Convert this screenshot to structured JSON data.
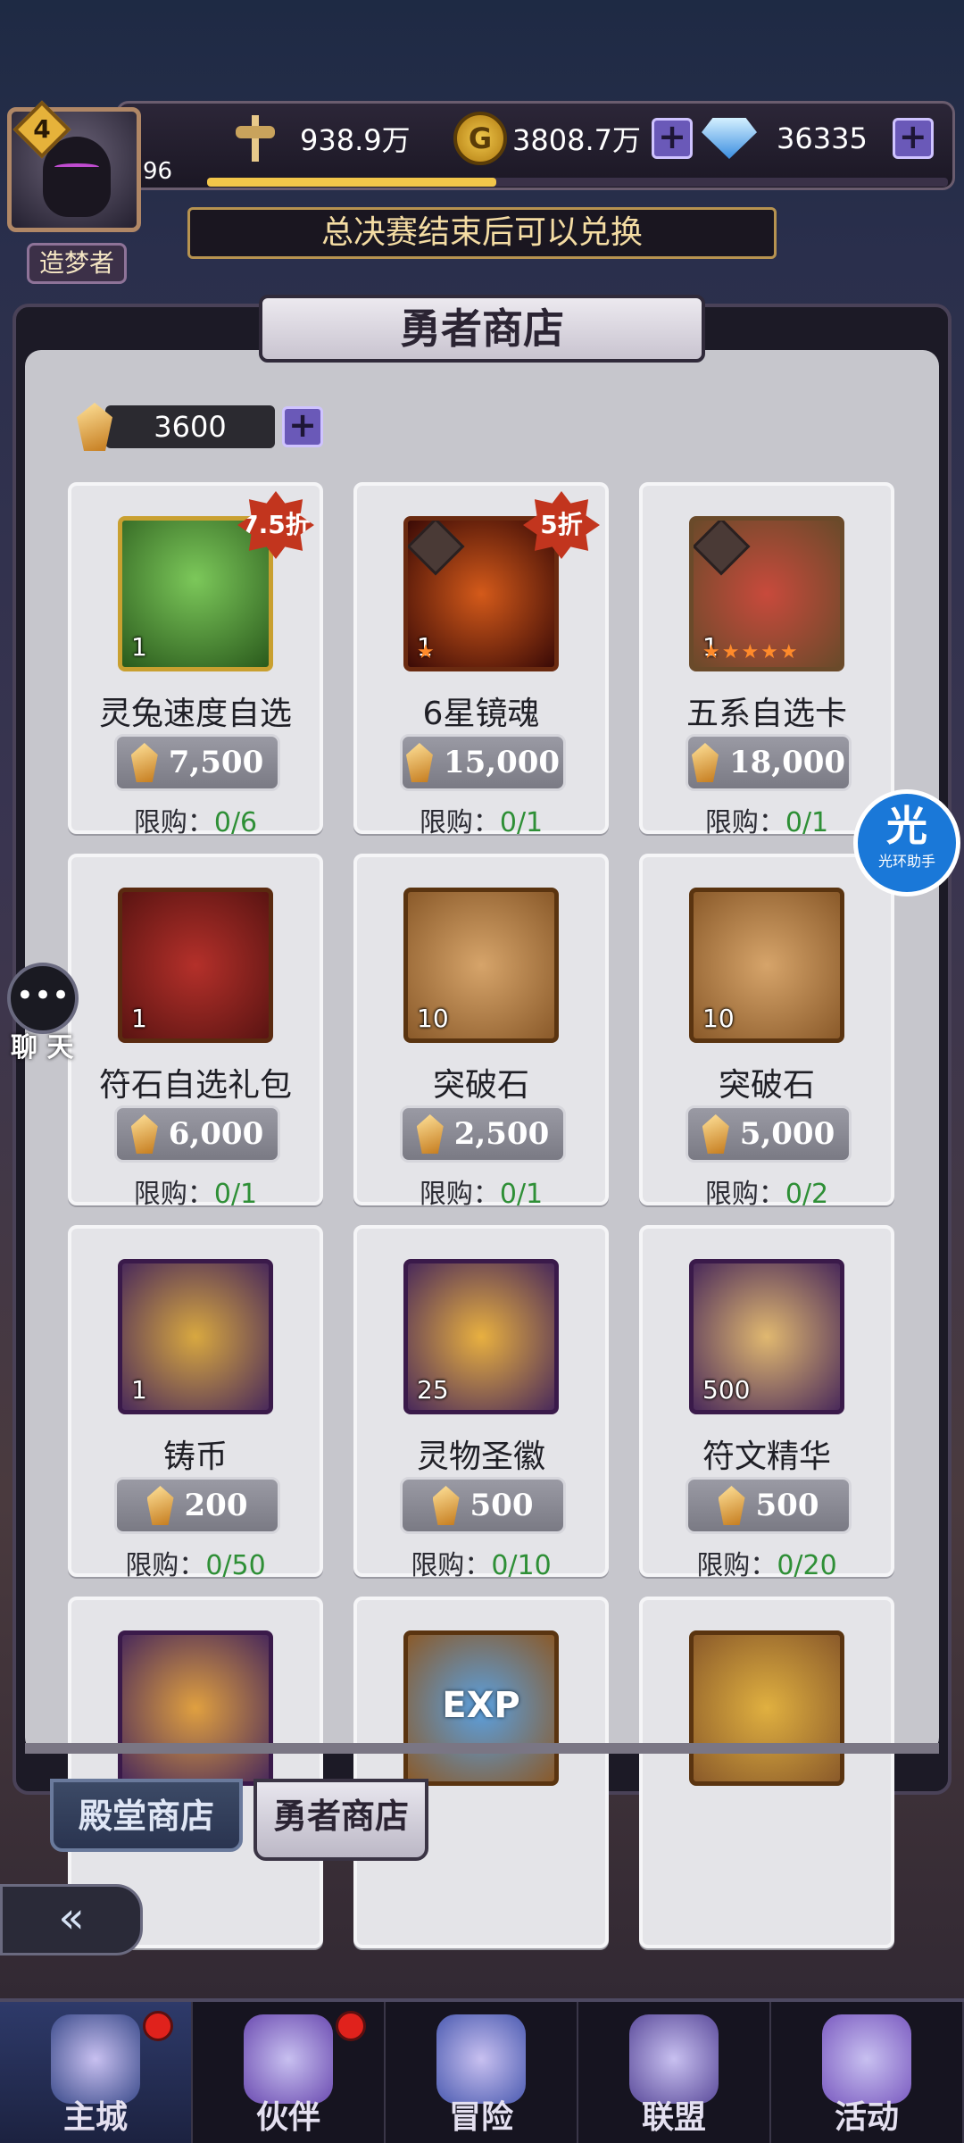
{
  "player": {
    "level": "4",
    "exp_value": "96",
    "title": "造梦者",
    "exp_progress": 0.39
  },
  "resources": {
    "power": "938.9万",
    "gold": "3808.7万",
    "diamond": "36335"
  },
  "banner_text": "总决赛结束后可以兑换",
  "shop": {
    "title": "勇者商店",
    "currency_amount": "3600",
    "items": [
      {
        "name": "灵兔速度自选",
        "qty": "1",
        "price": "7,500",
        "limit_label": "限购：",
        "limit_count": "0/6",
        "discount": "7.5折"
      },
      {
        "name": "6星镜魂",
        "qty": "1",
        "price": "15,000",
        "limit_label": "限购：",
        "limit_count": "0/1",
        "discount": "5折"
      },
      {
        "name": "五系自选卡",
        "qty": "1",
        "price": "18,000",
        "limit_label": "限购：",
        "limit_count": "0/1",
        "discount": ""
      },
      {
        "name": "符石自选礼包",
        "qty": "1",
        "price": "6,000",
        "limit_label": "限购：",
        "limit_count": "0/1",
        "discount": ""
      },
      {
        "name": "突破石",
        "qty": "10",
        "price": "2,500",
        "limit_label": "限购：",
        "limit_count": "0/1",
        "discount": ""
      },
      {
        "name": "突破石",
        "qty": "10",
        "price": "5,000",
        "limit_label": "限购：",
        "limit_count": "0/2",
        "discount": ""
      },
      {
        "name": "铸币",
        "qty": "1",
        "price": "200",
        "limit_label": "限购：",
        "limit_count": "0/50",
        "discount": ""
      },
      {
        "name": "灵物圣徽",
        "qty": "25",
        "price": "500",
        "limit_label": "限购：",
        "limit_count": "0/10",
        "discount": ""
      },
      {
        "name": "符文精华",
        "qty": "500",
        "price": "500",
        "limit_label": "限购：",
        "limit_count": "0/20",
        "discount": ""
      },
      {
        "name": "",
        "qty": "",
        "price": "",
        "limit_label": "",
        "limit_count": "",
        "discount": ""
      },
      {
        "name": "",
        "qty": "",
        "price": "",
        "limit_label": "",
        "limit_count": "",
        "discount": "",
        "icon_text": "EXP"
      },
      {
        "name": "",
        "qty": "",
        "price": "",
        "limit_label": "",
        "limit_count": "",
        "discount": ""
      }
    ]
  },
  "tabs": {
    "hall": "殿堂商店",
    "hero": "勇者商店"
  },
  "chat_label": "聊 天",
  "assistant": {
    "main": "光",
    "sub": "光环助手"
  },
  "nav": [
    {
      "label": "主城",
      "badge": true
    },
    {
      "label": "伙伴",
      "badge": true
    },
    {
      "label": "冒险",
      "badge": false
    },
    {
      "label": "联盟",
      "badge": false
    },
    {
      "label": "活动",
      "badge": false
    }
  ],
  "colors": {
    "accent_gold": "#f2c64a",
    "limit_green": "#2e8f36",
    "discount_red": "#c2351e"
  }
}
